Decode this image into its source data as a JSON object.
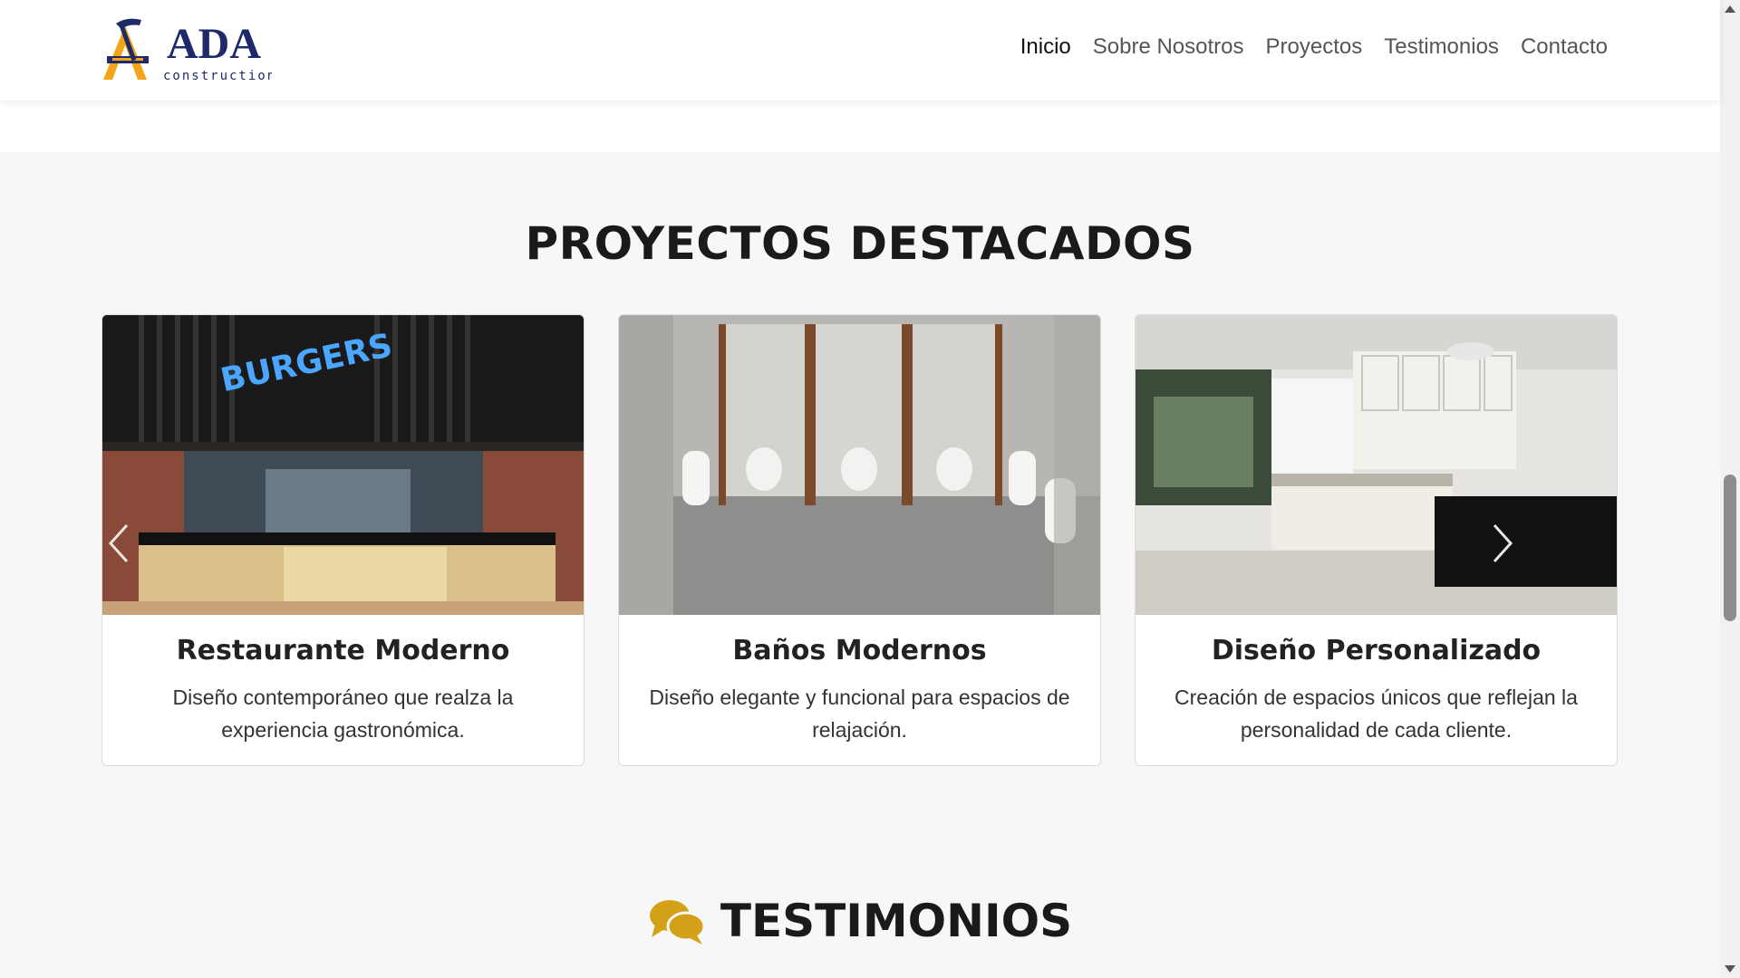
{
  "brand": {
    "name": "ADA",
    "sub": "construction",
    "colors": {
      "navy": "#1f2a6b",
      "orange": "#f2a51a"
    }
  },
  "nav": {
    "items": [
      "Inicio",
      "Sobre Nosotros",
      "Proyectos",
      "Testimonios",
      "Contacto"
    ],
    "active": "Inicio"
  },
  "projects": {
    "title": "PROYECTOS DESTACADOS",
    "cards": [
      {
        "title": "Restaurante Moderno",
        "desc": "Diseño contemporáneo que realza la experiencia gastronómica.",
        "image": "restaurant-counter-photo"
      },
      {
        "title": "Baños Modernos",
        "desc": "Diseño elegante y funcional para espacios de relajación.",
        "image": "bathroom-stalls-photo"
      },
      {
        "title": "Diseño Personalizado",
        "desc": "Creación de espacios únicos que reflejan la personalidad de cada cliente.",
        "image": "kitchen-interior-photo"
      }
    ]
  },
  "testimonials": {
    "title": "TESTIMONIOS",
    "icon": "chat-bubbles-icon",
    "icon_color": "#d4a017"
  }
}
